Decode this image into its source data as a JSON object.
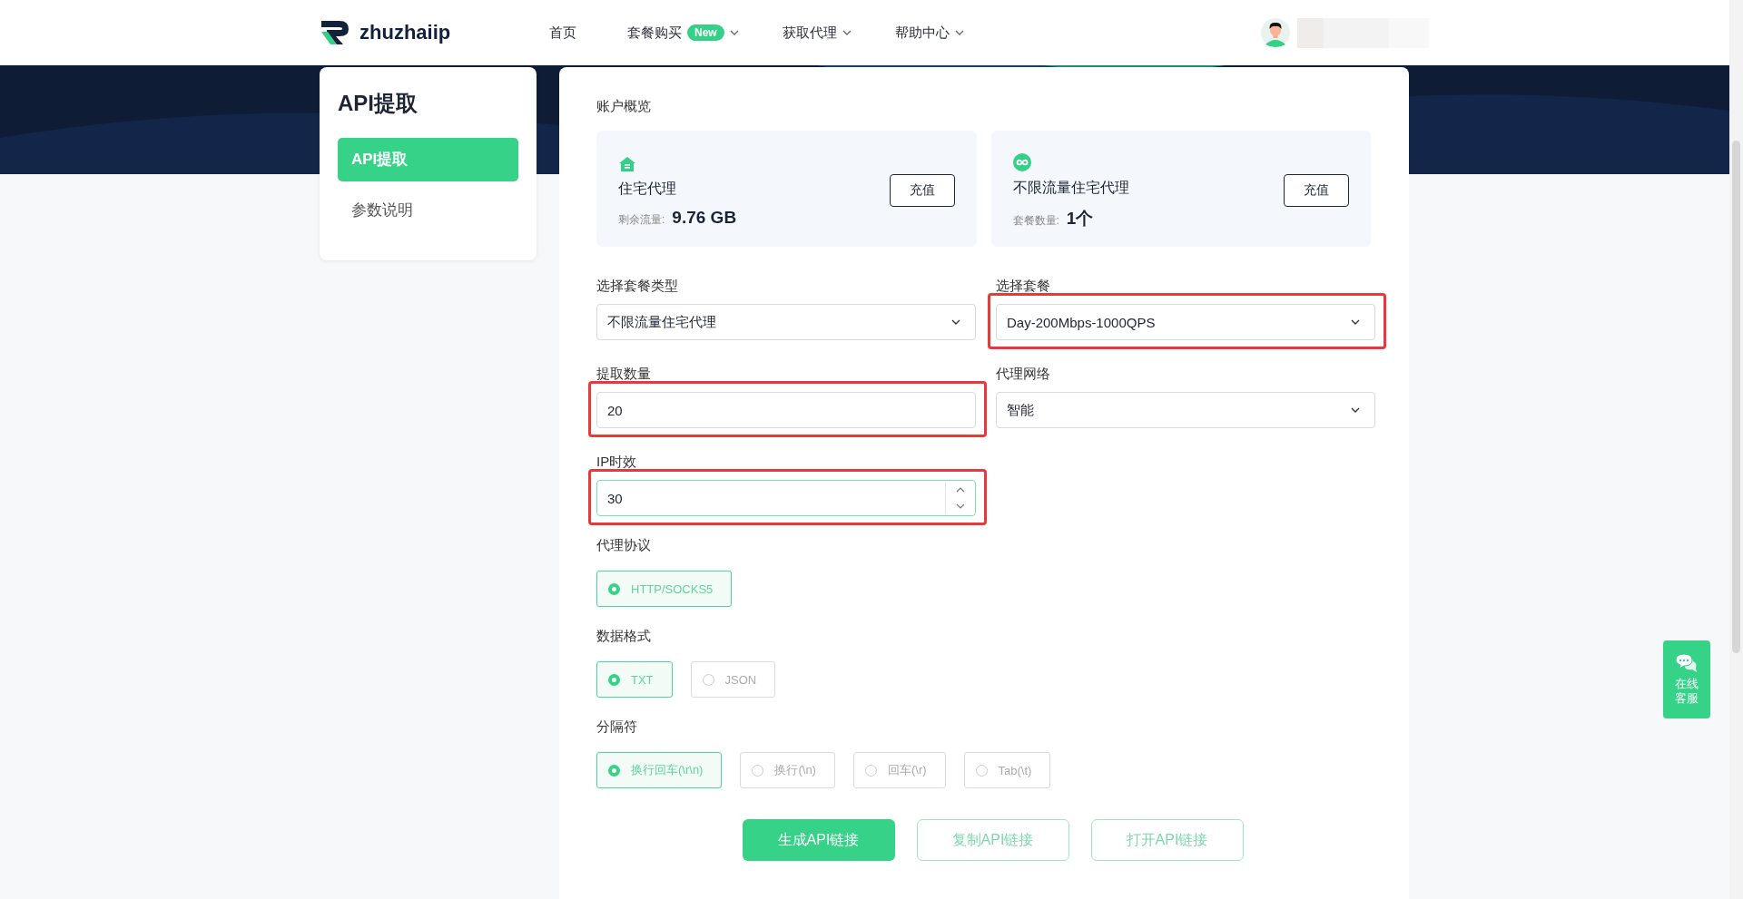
{
  "header": {
    "logo": "zhuzhaiip",
    "nav": [
      {
        "label": "首页",
        "dropdown": false
      },
      {
        "label": "套餐购买",
        "badge": "New",
        "dropdown": true
      },
      {
        "label": "获取代理",
        "dropdown": true
      },
      {
        "label": "帮助中心",
        "dropdown": true
      }
    ]
  },
  "sidebar": {
    "title": "API提取",
    "items": [
      {
        "label": "API提取",
        "selected": true
      },
      {
        "label": "参数说明",
        "selected": false
      }
    ]
  },
  "overview": {
    "title": "账户概览",
    "cards": [
      {
        "kind": "house",
        "name": "住宅代理",
        "stat_label": "剩余流量:",
        "stat_value": "9.76 GB",
        "button": "充值"
      },
      {
        "kind": "infinity",
        "name": "不限流量住宅代理",
        "stat_label": "套餐数量:",
        "stat_value": "1个",
        "button": "充值"
      }
    ]
  },
  "fields": [
    {
      "kind": "select",
      "label": "选择套餐类型",
      "value": "不限流量住宅代理",
      "highlighted": false
    },
    {
      "kind": "select",
      "label": "选择套餐",
      "value": "Day-200Mbps-1000QPS",
      "highlighted": true
    },
    {
      "kind": "text",
      "label": "提取数量",
      "value": "20",
      "highlighted": true
    },
    {
      "kind": "select",
      "label": "代理网络",
      "value": "智能",
      "highlighted": false
    },
    {
      "kind": "number",
      "label": "IP时效",
      "value": "30",
      "highlighted": true
    }
  ],
  "radio_groups": [
    {
      "label": "代理协议",
      "options": [
        {
          "label": "HTTP/SOCKS5",
          "selected": true
        }
      ]
    },
    {
      "label": "数据格式",
      "options": [
        {
          "label": "TXT",
          "selected": true
        },
        {
          "label": "JSON",
          "selected": false
        }
      ]
    },
    {
      "label": "分隔符",
      "options": [
        {
          "label": "换行回车(\\r\\n)",
          "selected": true
        },
        {
          "label": "换行(\\n)",
          "selected": false
        },
        {
          "label": "回车(\\r)",
          "selected": false
        },
        {
          "label": "Tab(\\t)",
          "selected": false
        }
      ]
    }
  ],
  "actions": [
    {
      "label": "生成API链接",
      "kind": "primary"
    },
    {
      "label": "复制API链接",
      "kind": "outline"
    },
    {
      "label": "打开API链接",
      "kind": "outline"
    }
  ],
  "chat_widget": {
    "label": "在线客服"
  }
}
